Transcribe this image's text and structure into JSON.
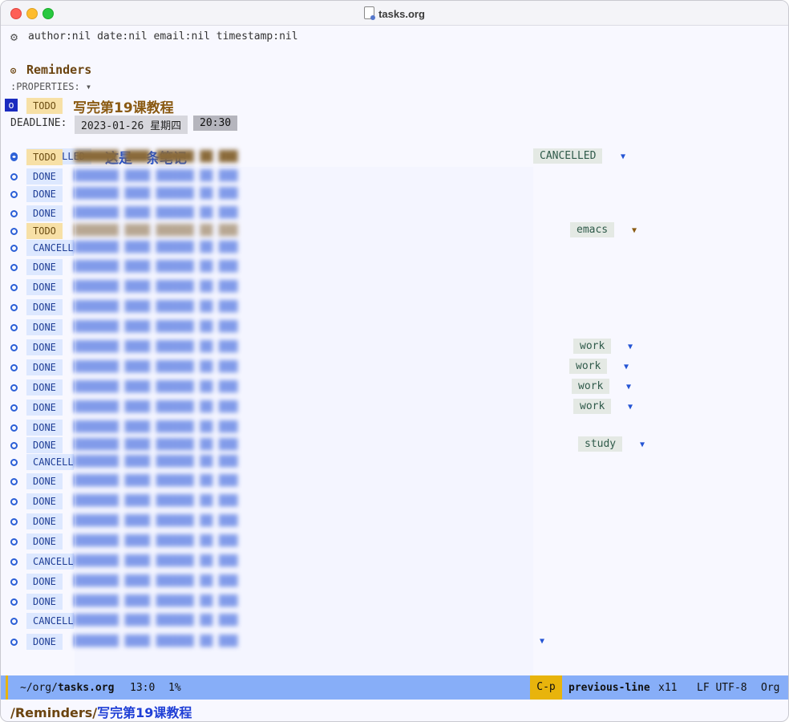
{
  "window": {
    "title": "tasks.org"
  },
  "file_options": "author:nil date:nil email:nil timestamp:nil",
  "heading": {
    "bullet": "⊙",
    "title": "Reminders"
  },
  "properties_drawer": ":PROPERTIES: ▾",
  "cursor_glyph": "o",
  "current_task": {
    "keyword": "TODO",
    "title": "写完第19课教程",
    "deadline_label": "DEADLINE:",
    "deadline_date": "2023-01-26 星期四",
    "deadline_time": "20:30"
  },
  "first_entry": {
    "keyword": "CANCELLED",
    "title": "这是一条笔记",
    "tag": "CANCELLED"
  },
  "entries": [
    {
      "keyword": "TODO"
    },
    {
      "keyword": "DONE"
    },
    {
      "keyword": "DONE"
    },
    {
      "keyword": "DONE"
    },
    {
      "keyword": "TODO",
      "tag": "emacs"
    },
    {
      "keyword": "CANCELL"
    },
    {
      "keyword": "DONE"
    },
    {
      "keyword": "DONE"
    },
    {
      "keyword": "DONE"
    },
    {
      "keyword": "DONE"
    },
    {
      "keyword": "DONE",
      "tag": "work"
    },
    {
      "keyword": "DONE",
      "tag": "work"
    },
    {
      "keyword": "DONE",
      "tag": "work"
    },
    {
      "keyword": "DONE",
      "tag": "work"
    },
    {
      "keyword": "DONE"
    },
    {
      "keyword": "DONE",
      "tag": "study"
    },
    {
      "keyword": "CANCELL"
    },
    {
      "keyword": "DONE"
    },
    {
      "keyword": "DONE"
    },
    {
      "keyword": "DONE"
    },
    {
      "keyword": "DONE"
    },
    {
      "keyword": "CANCELL"
    },
    {
      "keyword": "DONE"
    },
    {
      "keyword": "DONE"
    },
    {
      "keyword": "CANCELL"
    },
    {
      "keyword": "DONE"
    }
  ],
  "modeline": {
    "path_prefix": "~/org/",
    "file": "tasks.org",
    "position": "13:0",
    "percent": "1%",
    "key": "C-p",
    "command": "previous-line",
    "count": "x11",
    "encoding": "LF UTF-8",
    "mode": "Org"
  },
  "minibuffer": {
    "part1": "Reminders",
    "part2": "写完第19课教程"
  },
  "colors": {
    "modeline_bg": "#87aef8",
    "key_bg": "#e8b40c",
    "todo_bg": "#f7e0a6",
    "done_bg": "#dde8ff"
  }
}
